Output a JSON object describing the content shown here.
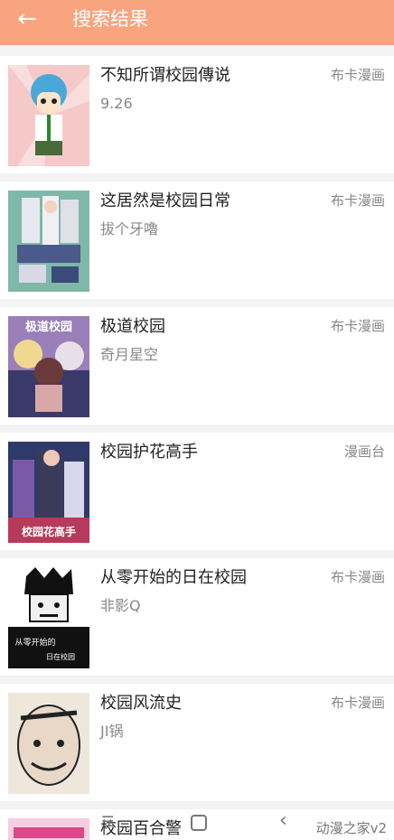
{
  "header": {
    "back_icon": "arrow-left-icon",
    "title": "搜索结果",
    "color": "#f8a47f"
  },
  "results": [
    {
      "title": "不知所谓校园傳说",
      "author": "9.26",
      "source": "布卡漫画"
    },
    {
      "title": "这居然是校园日常",
      "author": "拔个牙嚕",
      "source": "布卡漫画"
    },
    {
      "title": "极道校园",
      "author": "奇月星空",
      "source": "布卡漫画"
    },
    {
      "title": "校园护花高手",
      "author": "",
      "source": "漫画台"
    },
    {
      "title": "从零开始的日在校园",
      "author": "非影Q",
      "source": "布卡漫画"
    },
    {
      "title": "校园风流史",
      "author": "JI锅",
      "source": "布卡漫画"
    },
    {
      "title": "校园百合警",
      "author": "",
      "source": ""
    }
  ],
  "covers": {
    "c1_text": "",
    "c3_text": "极道校园",
    "c4_text": "校园花高手",
    "c5_text_1": "从零开始的",
    "c5_text_2": "日在校园"
  },
  "navbar": {
    "menu_icon": "menu-icon",
    "home_icon": "home-square-icon",
    "back_icon": "back-triangle-icon",
    "watermark": "动漫之家v2"
  }
}
